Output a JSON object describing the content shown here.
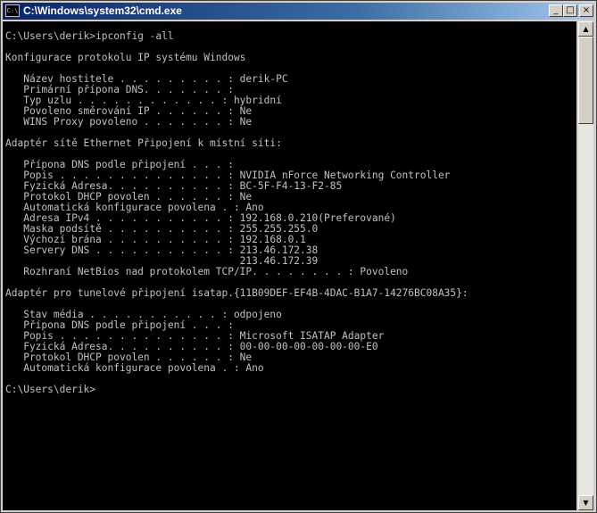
{
  "window": {
    "title": "C:\\Windows\\system32\\cmd.exe",
    "icon": "cmd-icon",
    "controls": {
      "minimize": "_",
      "maximize": "□",
      "close": "×"
    }
  },
  "scrollbar": {
    "up_arrow": "▲",
    "down_arrow": "▼",
    "thumb_position": 0
  },
  "console": {
    "lines": [
      "C:\\Users\\derik>ipconfig -all",
      "",
      "Konfigurace protokolu IP systému Windows",
      "",
      "   Název hostitele . . . . . . . . . : derik-PC",
      "   Primární přípona DNS. . . . . . . :",
      "   Typ uzlu . . . . . . . . . . . . : hybridní",
      "   Povoleno směrování IP . . . . . . : Ne",
      "   WINS Proxy povoleno . . . . . . . : Ne",
      "",
      "Adaptér sítě Ethernet Připojení k místní síti:",
      "",
      "   Přípona DNS podle připojení . . . :",
      "   Popis . . . . . . . . . . . . . . : NVIDIA nForce Networking Controller",
      "   Fyzická Adresa. . . . . . . . . . : BC-5F-F4-13-F2-85",
      "   Protokol DHCP povolen . . . . . . : Ne",
      "   Automatická konfigurace povolena . : Ano",
      "   Adresa IPv4 . . . . . . . . . . . : 192.168.0.210(Preferované)",
      "   Maska podsítě . . . . . . . . . . : 255.255.255.0",
      "   Výchozí brána . . . . . . . . . . : 192.168.0.1",
      "   Servery DNS . . . . . . . . . . . : 213.46.172.38",
      "                                       213.46.172.39",
      "   Rozhraní NetBios nad protokolem TCP/IP. . . . . . . . : Povoleno",
      "",
      "Adaptér pro tunelové připojení isatap.{11B09DEF-EF4B-4DAC-B1A7-14276BC08A35}:",
      "",
      "   Stav média . . . . . . . . . . . : odpojeno",
      "   Přípona DNS podle připojení . . . :",
      "   Popis . . . . . . . . . . . . . . : Microsoft ISATAP Adapter",
      "   Fyzická Adresa. . . . . . . . . . : 00-00-00-00-00-00-00-E0",
      "   Protokol DHCP povolen . . . . . . : Ne",
      "   Automatická konfigurace povolena . : Ano",
      "",
      "C:\\Users\\derik>"
    ]
  }
}
